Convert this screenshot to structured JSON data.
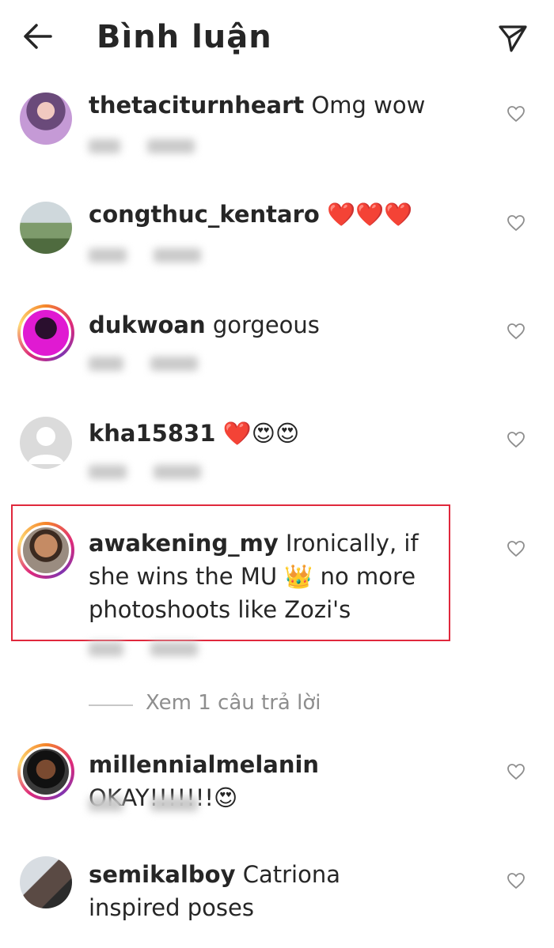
{
  "header": {
    "title": "Bình luận",
    "back_icon": "arrow-left-icon",
    "send_icon": "paper-plane-icon"
  },
  "comments": [
    {
      "username": "thetaciturnheart",
      "text": " Omg wow"
    },
    {
      "username": "congthuc_kentaro",
      "text": " ❤️❤️❤️"
    },
    {
      "username": "dukwoan",
      "text": " gorgeous"
    },
    {
      "username": "kha15831",
      "text": " ❤️😍😍"
    },
    {
      "username": "awakening_my",
      "text": " Ironically, if she wins the MU 👑 no more photoshoots like Zozi's"
    },
    {
      "username": "millennialmelanin",
      "text": " OKAY!!!!!!!😍"
    },
    {
      "username": "semikalboy",
      "text": " Catriona inspired poses"
    }
  ],
  "view_replies": "Xem 1 câu trả lời",
  "colors": {
    "highlight": "#e0283c",
    "ring_gradient_start": "#f58529",
    "ring_gradient_end": "#dd2a7b"
  }
}
